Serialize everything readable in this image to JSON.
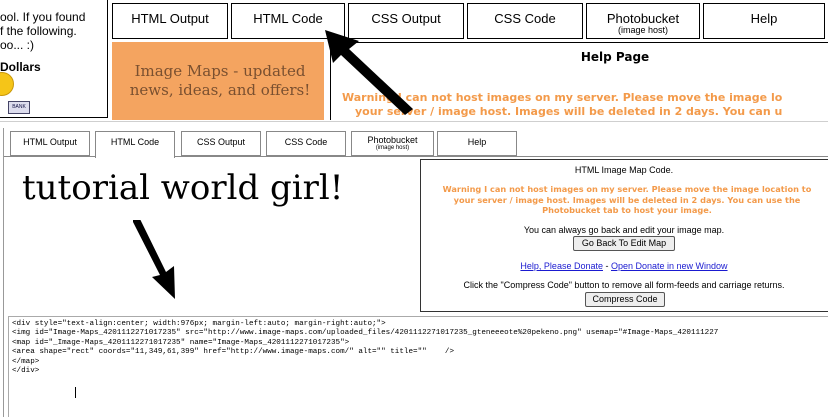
{
  "top_left_text": {
    "line1": "ool. If you found",
    "line2": "f the following.",
    "line3": "oo... :)",
    "dollars": "Dollars",
    "bank_badge": "BANK"
  },
  "top_tabs": [
    {
      "label": "HTML Output",
      "sub": ""
    },
    {
      "label": "HTML Code",
      "sub": ""
    },
    {
      "label": "CSS Output",
      "sub": ""
    },
    {
      "label": "CSS Code",
      "sub": ""
    },
    {
      "label": "Photobucket",
      "sub": "(image host)"
    },
    {
      "label": "Help",
      "sub": ""
    }
  ],
  "promo": {
    "text": "Image Maps - updated news, ideas, and offers!",
    "bg": "#f4a460",
    "color": "#7a4a2a"
  },
  "help_page": {
    "title": "Help Page",
    "warning_line1": "Warning I can not host images on my server. Please move the image lo",
    "warning_line2": "your server / image host. Images will be deleted in 2 days. You can u"
  },
  "inner_tabs": [
    {
      "label": "HTML Output",
      "sub": ""
    },
    {
      "label": "HTML Code",
      "sub": ""
    },
    {
      "label": "CSS Output",
      "sub": ""
    },
    {
      "label": "CSS Code",
      "sub": ""
    },
    {
      "label": "Photobucket",
      "sub": "(image host)"
    },
    {
      "label": "Help",
      "sub": ""
    }
  ],
  "annotation": {
    "text": "tutorial world girl!"
  },
  "info_panel": {
    "title": "HTML Image Map Code.",
    "warning": "Warning I can not host images on my server. Please move the image location to your server / image host. Images will be deleted in 2 days. You can use the Photobucket tab to host your image.",
    "edit_text": "You can always go back and edit your image map.",
    "back_button": "Go Back To Edit Map",
    "donate_link": "Help, Please Donate",
    "donate_sep": " - ",
    "donate_new_window_link": "Open Donate in new Window",
    "compress_text": "Click the \"Compress Code\" button to remove all form-feeds and carriage returns.",
    "compress_button": "Compress Code"
  },
  "code_lines": [
    "<div style=\"text-align:center; width:976px; margin-left:auto; margin-right:auto;\">",
    "<img id=\"Image-Maps_4201112271017235\" src=\"http://www.image-maps.com/uploaded_files/4201112271017235_gteneeeote%20pekeno.png\" usemap=\"#Image-Maps_420111227",
    "<map id=\"_Image-Maps_4201112271017235\" name=\"Image-Maps_4201112271017235\">",
    "<area shape=\"rect\" coords=\"11,349,61,399\" href=\"http://www.image-maps.com/\" alt=\"\" title=\"\"    />",
    "</map>",
    "</div>"
  ],
  "colors": {
    "accent_orange": "#f39a4a",
    "link_blue": "#1a1ad0",
    "promo_bg": "#f4a460"
  },
  "icons": [
    "arrow-icon",
    "arrow-icon",
    "coin-icon"
  ]
}
